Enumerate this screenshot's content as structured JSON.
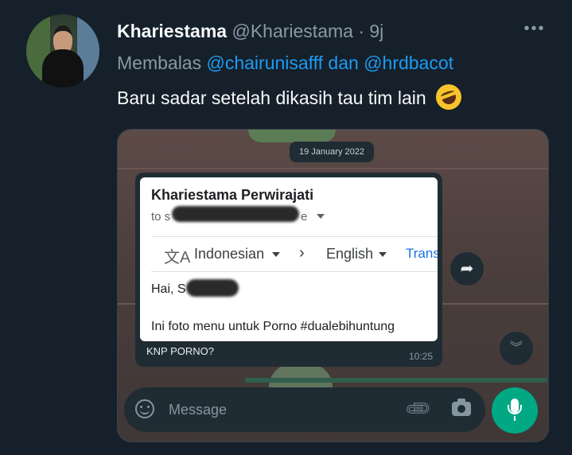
{
  "tweet": {
    "display_name": "Khariestama",
    "handle": "@Khariestama",
    "separator": "·",
    "time": "9j",
    "more_label": "•••",
    "reply_prefix": "Membalas",
    "reply_to": "@chairunisafff dan @hrdbacot",
    "text": "Baru sadar setelah dikasih tau tim lain",
    "emoji": "rolling-on-floor-laughing-emoji"
  },
  "whatsapp": {
    "date_pill": "19 January 2022",
    "email": {
      "sender": "Khariestama Perwirajati",
      "to_prefix": "to s",
      "to_suffix": "e",
      "translate_from": "Indonesian",
      "translate_to": "English",
      "translate_button": "Trans",
      "greeting": "Hai, S",
      "body": "Ini foto menu untuk Porno #dualebihuntung"
    },
    "caption": "KNP PORNO?",
    "timestamp": "10:25",
    "input_placeholder": "Message",
    "accent_color": "#00a884"
  },
  "colors": {
    "background": "#15202b",
    "link": "#1d9bf0",
    "muted": "#8b98a5"
  }
}
